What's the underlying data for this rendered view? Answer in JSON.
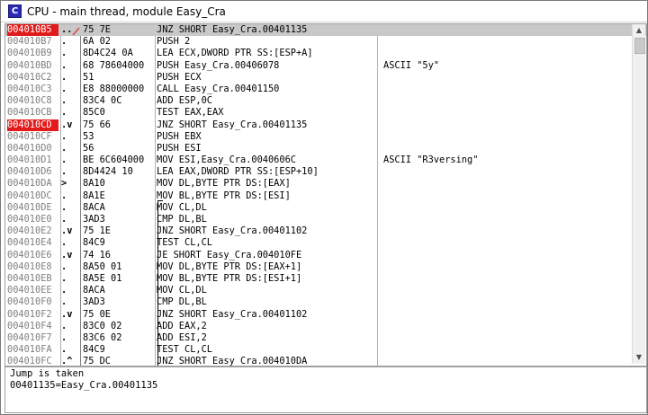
{
  "window": {
    "title": "CPU - main thread, module Easy_Cra",
    "icon_letter": "C"
  },
  "colors": {
    "breakpoint": "#e11b1b",
    "current_row": "#c8c8c8",
    "address_text": "#808080"
  },
  "rows": [
    {
      "addr": "004010B5",
      "mark": "..",
      "hex": "75 7E",
      "instr": "JNZ SHORT Easy_Cra.00401135",
      "comment": "",
      "current": true,
      "bp": true
    },
    {
      "addr": "004010B7",
      "mark": ".",
      "hex": "6A 02",
      "instr": "PUSH 2",
      "comment": ""
    },
    {
      "addr": "004010B9",
      "mark": ".",
      "hex": "8D4C24 0A",
      "instr": "LEA ECX,DWORD PTR SS:[ESP+A]",
      "comment": ""
    },
    {
      "addr": "004010BD",
      "mark": ".",
      "hex": "68 78604000",
      "instr": "PUSH Easy_Cra.00406078",
      "comment": "ASCII \"5y\""
    },
    {
      "addr": "004010C2",
      "mark": ".",
      "hex": "51",
      "instr": "PUSH ECX",
      "comment": ""
    },
    {
      "addr": "004010C3",
      "mark": ".",
      "hex": "E8 88000000",
      "instr": "CALL Easy_Cra.00401150",
      "comment": ""
    },
    {
      "addr": "004010C8",
      "mark": ".",
      "hex": "83C4 0C",
      "instr": "ADD ESP,0C",
      "comment": ""
    },
    {
      "addr": "004010CB",
      "mark": ".",
      "hex": "85C0",
      "instr": "TEST EAX,EAX",
      "comment": ""
    },
    {
      "addr": "004010CD",
      "mark": ".v",
      "hex": "75 66",
      "instr": "JNZ SHORT Easy_Cra.00401135",
      "comment": "",
      "bp": true
    },
    {
      "addr": "004010CF",
      "mark": ".",
      "hex": "53",
      "instr": "PUSH EBX",
      "comment": ""
    },
    {
      "addr": "004010D0",
      "mark": ".",
      "hex": "56",
      "instr": "PUSH ESI",
      "comment": ""
    },
    {
      "addr": "004010D1",
      "mark": ".",
      "hex": "BE 6C604000",
      "instr": "MOV ESI,Easy_Cra.0040606C",
      "comment": "ASCII \"R3versing\""
    },
    {
      "addr": "004010D6",
      "mark": ".",
      "hex": "8D4424 10",
      "instr": "LEA EAX,DWORD PTR SS:[ESP+10]",
      "comment": ""
    },
    {
      "addr": "004010DA",
      "mark": ">",
      "hex": "8A10",
      "instr": "MOV DL,BYTE PTR DS:[EAX]",
      "comment": ""
    },
    {
      "addr": "004010DC",
      "mark": ".",
      "hex": "8A1E",
      "instr": "MOV BL,BYTE PTR DS:[ESI]",
      "comment": ""
    },
    {
      "addr": "004010DE",
      "mark": ".",
      "hex": "8ACA",
      "instr": "MOV CL,DL",
      "comment": ""
    },
    {
      "addr": "004010E0",
      "mark": ".",
      "hex": "3AD3",
      "instr": "CMP DL,BL",
      "comment": ""
    },
    {
      "addr": "004010E2",
      "mark": ".v",
      "hex": "75 1E",
      "instr": "JNZ SHORT Easy_Cra.00401102",
      "comment": ""
    },
    {
      "addr": "004010E4",
      "mark": ".",
      "hex": "84C9",
      "instr": "TEST CL,CL",
      "comment": ""
    },
    {
      "addr": "004010E6",
      "mark": ".v",
      "hex": "74 16",
      "instr": "JE SHORT Easy_Cra.004010FE",
      "comment": ""
    },
    {
      "addr": "004010E8",
      "mark": ".",
      "hex": "8A50 01",
      "instr": "MOV DL,BYTE PTR DS:[EAX+1]",
      "comment": ""
    },
    {
      "addr": "004010EB",
      "mark": ".",
      "hex": "8A5E 01",
      "instr": "MOV BL,BYTE PTR DS:[ESI+1]",
      "comment": ""
    },
    {
      "addr": "004010EE",
      "mark": ".",
      "hex": "8ACA",
      "instr": "MOV CL,DL",
      "comment": ""
    },
    {
      "addr": "004010F0",
      "mark": ".",
      "hex": "3AD3",
      "instr": "CMP DL,BL",
      "comment": ""
    },
    {
      "addr": "004010F2",
      "mark": ".v",
      "hex": "75 0E",
      "instr": "JNZ SHORT Easy_Cra.00401102",
      "comment": ""
    },
    {
      "addr": "004010F4",
      "mark": ".",
      "hex": "83C0 02",
      "instr": "ADD EAX,2",
      "comment": ""
    },
    {
      "addr": "004010F7",
      "mark": ".",
      "hex": "83C6 02",
      "instr": "ADD ESI,2",
      "comment": ""
    },
    {
      "addr": "004010FA",
      "mark": ".",
      "hex": "84C9",
      "instr": "TEST CL,CL",
      "comment": ""
    },
    {
      "addr": "004010FC",
      "mark": ".^",
      "hex": "75 DC",
      "instr": "JNZ SHORT Easy_Cra.004010DA",
      "comment": ""
    }
  ],
  "info": {
    "line1": "Jump is taken",
    "line2": "00401135=Easy_Cra.00401135"
  }
}
